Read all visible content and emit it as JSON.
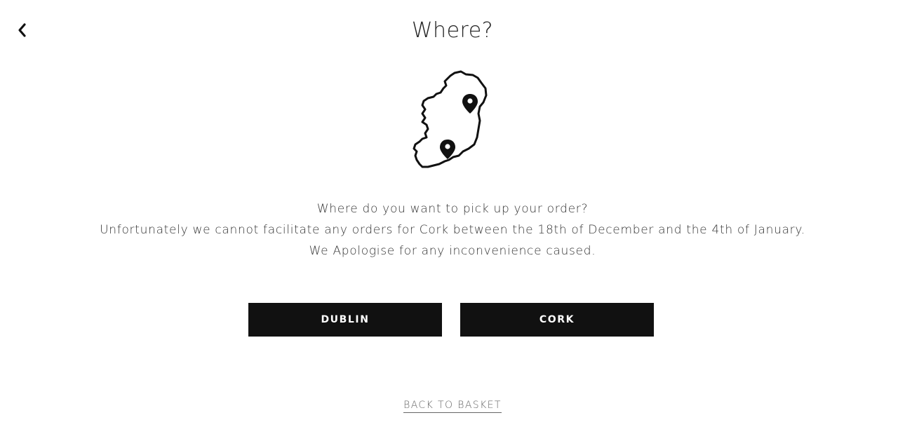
{
  "header": {
    "back_icon": "chevron-left-icon",
    "title": "Where?"
  },
  "illustration": {
    "icon": "ireland-map-icon",
    "pins": [
      "map-pin-icon",
      "map-pin-icon"
    ]
  },
  "message": {
    "line1": "Where do you want to pick up your order?",
    "line2": "Unfortunately we cannot facilitate any orders for Cork between the 18th of December and the 4th of January.",
    "line3": "We Apologise for any inconvenience caused."
  },
  "locations": {
    "dublin_label": "DUBLIN",
    "cork_label": "CORK"
  },
  "footer": {
    "back_to_basket": "BACK TO BASKET"
  },
  "colors": {
    "button_bg": "#111111",
    "button_text": "#ffffff",
    "link_text": "#666666"
  }
}
